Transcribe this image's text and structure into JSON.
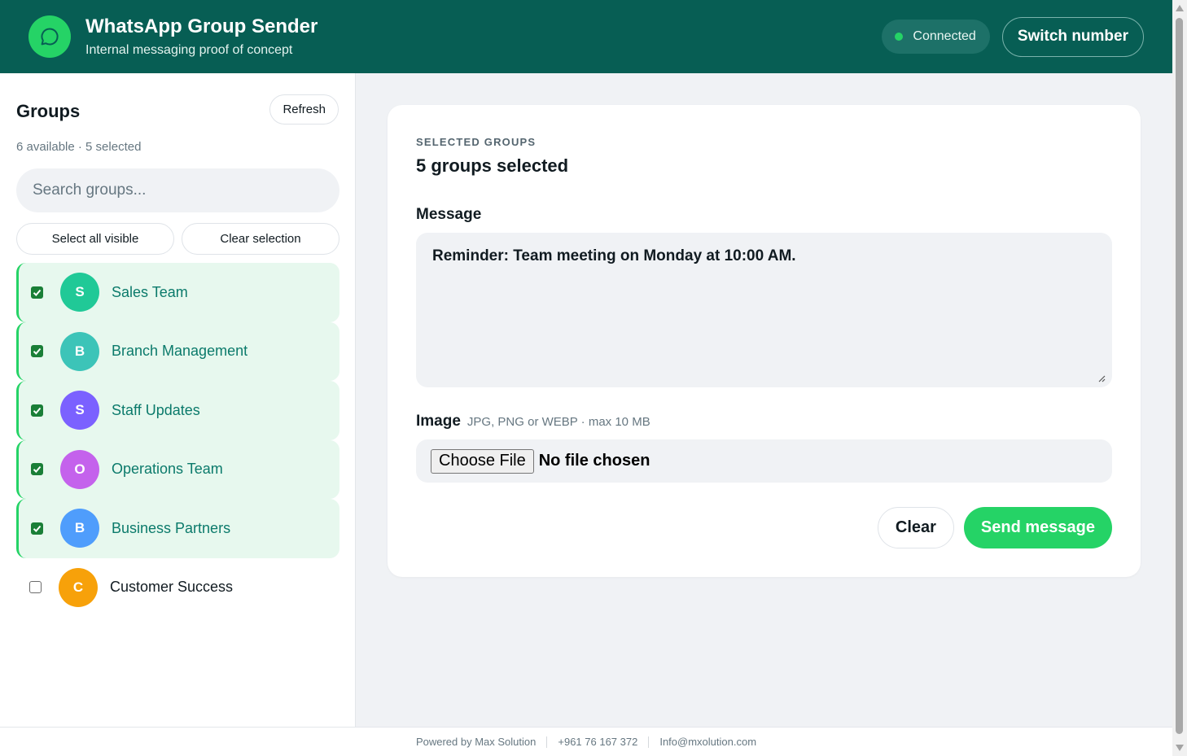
{
  "header": {
    "title": "WhatsApp Group Sender",
    "subtitle": "Internal messaging proof of concept",
    "status": "Connected",
    "switch_label": "Switch number",
    "accent": "#25d366",
    "bg": "#075e54"
  },
  "sidebar": {
    "title": "Groups",
    "refresh_label": "Refresh",
    "count_text": "6 available · 5 selected",
    "search_placeholder": "Search groups...",
    "select_all_label": "Select all visible",
    "clear_selection_label": "Clear selection",
    "groups": [
      {
        "initial": "S",
        "name": "Sales Team",
        "selected": true,
        "color": "#20c997"
      },
      {
        "initial": "B",
        "name": "Branch Management",
        "selected": true,
        "color": "#3cc4b8"
      },
      {
        "initial": "S",
        "name": "Staff Updates",
        "selected": true,
        "color": "#7b61ff"
      },
      {
        "initial": "O",
        "name": "Operations Team",
        "selected": true,
        "color": "#c462ec"
      },
      {
        "initial": "B",
        "name": "Business Partners",
        "selected": true,
        "color": "#4f9dfc"
      },
      {
        "initial": "C",
        "name": "Customer Success",
        "selected": false,
        "color": "#f7a10a"
      }
    ]
  },
  "main": {
    "eyebrow": "SELECTED GROUPS",
    "selected_title": "5 groups selected",
    "message_label": "Message",
    "message_value": "Reminder: Team meeting on Monday at 10:00 AM.",
    "image_label": "Image",
    "image_hint": "JPG, PNG or WEBP · max 10 MB",
    "choose_file_label": "Choose File",
    "no_file_text": "No file chosen",
    "clear_label": "Clear",
    "send_label": "Send message"
  },
  "footer": {
    "powered_by": "Powered by Max Solution",
    "phone": "+961 76 167 372",
    "email": "Info@mxolution.com"
  }
}
